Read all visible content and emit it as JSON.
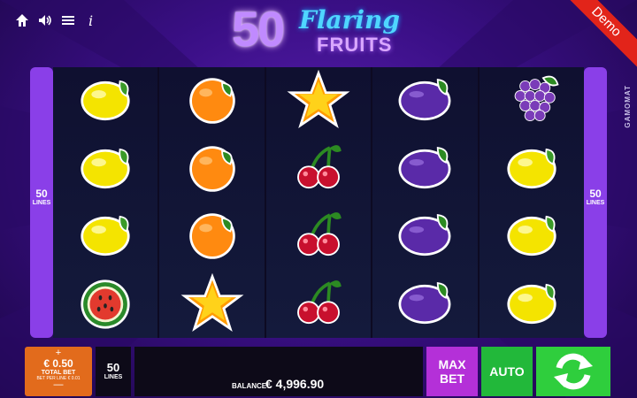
{
  "top_icons": [
    "home-icon",
    "sound-icon",
    "menu-icon",
    "info-icon"
  ],
  "logo": {
    "number": "50",
    "word1": "Flaring",
    "word2": "FRUITS"
  },
  "ribbon": "Demo",
  "provider": "GAMOMAT",
  "side": {
    "lines_count": "50",
    "lines_label": "LINES"
  },
  "reels": [
    [
      "lemon",
      "lemon",
      "lemon",
      "watermelon"
    ],
    [
      "orange",
      "orange",
      "orange",
      "star"
    ],
    [
      "star",
      "cherry",
      "cherry",
      "cherry"
    ],
    [
      "plum",
      "plum",
      "plum",
      "plum"
    ],
    [
      "grapes",
      "lemon",
      "lemon",
      "lemon"
    ]
  ],
  "bottom": {
    "bet_plus": "+",
    "bet_amount": "€ 0.50",
    "bet_label": "TOTAL BET",
    "bet_per_line": "BET PER LINE € 0.01",
    "bet_minus": "—",
    "lines_value": "50",
    "lines_label": "LINES",
    "balance_label": "BALANCE",
    "balance_value": "€ 4,996.90",
    "maxbet_line1": "MAX",
    "maxbet_line2": "BET",
    "auto_label": "AUTO"
  },
  "colors": {
    "lemon": "#f4e400",
    "orange": "#ff8a10",
    "plum": "#5a2aa8",
    "cherry": "#c8102e",
    "star": "#ffd21a",
    "accent_purple": "#8a3fe8",
    "spin_green": "#2fce3d"
  }
}
